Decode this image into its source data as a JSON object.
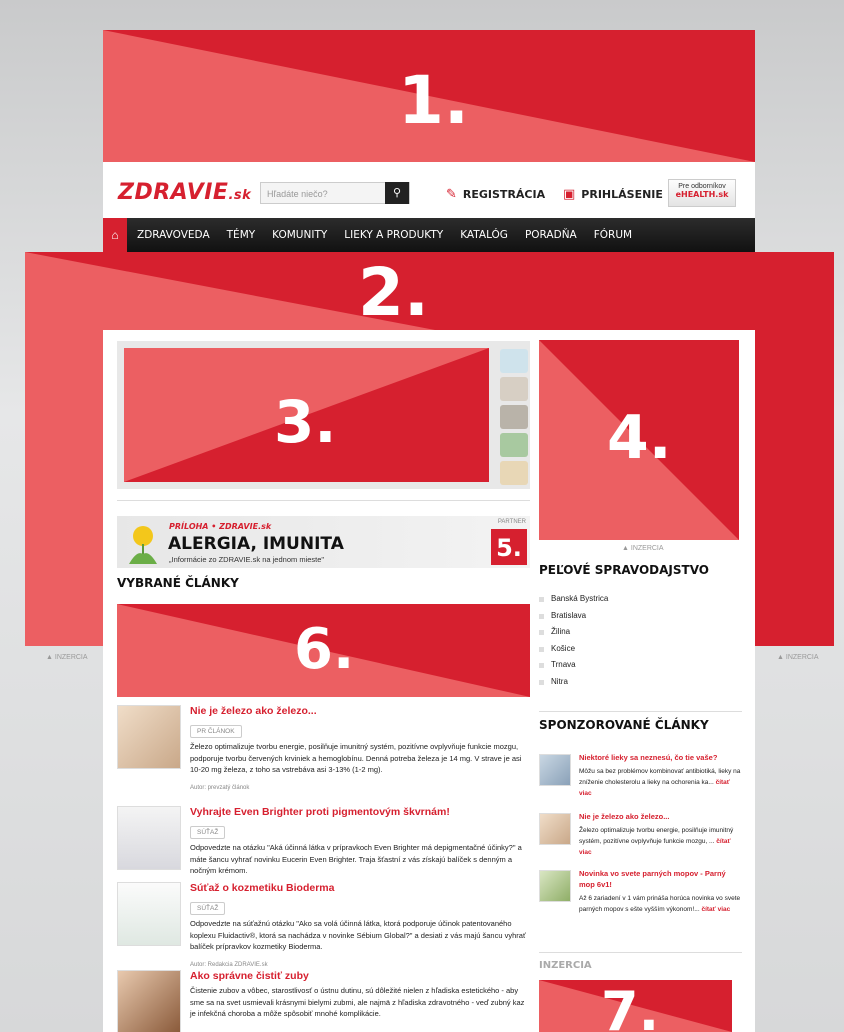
{
  "ads": {
    "ad1": "1.",
    "ad2": "2.",
    "ad3": "3.",
    "ad4": "4.",
    "ad5": "5.",
    "ad6": "6.",
    "ad7": "7.",
    "inzercia_small": "▲ INZERCIA",
    "inzercia_heading": "INZERCIA"
  },
  "header": {
    "logo": "ZDRAVIE",
    "logo_suffix": ".sk",
    "search_placeholder": "Hľadáte niečo?",
    "register": "REGISTRÁCIA",
    "login": "PRIHLÁSENIE",
    "ehealth_line1": "Pre odborníkov",
    "ehealth_line2": "eHEALTH.sk"
  },
  "nav": [
    "ZDRAVOVEDA",
    "TÉMY",
    "KOMUNITY",
    "LIEKY A PRODUKTY",
    "KATALÓG",
    "PORADŇA",
    "FÓRUM"
  ],
  "partner_banner": {
    "priloha": "PRÍLOHA • ZDRAVIE.sk",
    "title": "ALERGIA, IMUNITA",
    "subtitle": "„Informácie zo ZDRAVIE.sk na jednom mieste\"",
    "partner": "PARTNER"
  },
  "main": {
    "selected_title": "VYBRANÉ ČLÁNKY",
    "articles": [
      {
        "title": "Nie je železo ako železo...",
        "tag": "PR ČLÁNOK",
        "text": "Železo optimalizuje tvorbu energie, posilňuje imunitný systém, pozitívne ovplyvňuje funkcie mozgu, podporuje tvorbu červených krviniek a hemoglobínu. Denná potreba železa je 14 mg. V strave je asi 10-20 mg železa, z toho sa vstrebáva asi 3-13% (1-2 mg).",
        "autor": "Autor: prevzatý článok"
      },
      {
        "title": "Vyhrajte Even Brighter proti pigmentovým škvrnám!",
        "tag": "SÚŤAŽ",
        "text": "Odpovedzte na otázku \"Aká účinná látka v prípravkoch Even Brighter má depigmentačné účinky?\" a máte šancu vyhrať novinku Eucerin Even Brighter. Traja šťastní z vás získajú balíček s denným a nočným krémom.",
        "autor": ""
      },
      {
        "title": "Súťaž o kozmetiku Bioderma",
        "tag": "SÚŤAŽ",
        "text": "Odpovedzte na súťažnú otázku \"Ako sa volá účinná látka, ktorá podporuje účinok patentovaného koplexu Fluidactiv®, ktorá sa nachádza v novinke Sébium Global?\" a desiati z vás majú šancu vyhrať balíček prípravkov kozmetiky Bioderma.",
        "autor": "Autor: Redakcia ZDRAVIE.sk"
      },
      {
        "title": "Ako správne čistiť zuby",
        "tag": "",
        "text": "Čistenie zubov a vôbec, starostlivosť o ústnu dutinu, sú dôležité nielen z hľadiska estetického - aby sme sa na svet usmievali krásnymi bielymi zubmi, ale najmä z hľadiska zdravotného - veď zubný kaz je infekčná choroba a môže spôsobiť mnohé komplikácie.",
        "autor": ""
      }
    ]
  },
  "sidebar": {
    "pollen_title": "PEĽOVÉ SPRAVODAJSTVO",
    "cities": [
      "Banská Bystrica",
      "Bratislava",
      "Žilina",
      "Košice",
      "Trnava",
      "Nitra"
    ],
    "sponsored_title": "SPONZOROVANÉ ČLÁNKY",
    "sponsored": [
      {
        "title": "Niektoré lieky sa neznesú, čo tie vaše?",
        "text": "Môžu sa bez problémov kombinovať antibiotiká, lieky na zníženie cholesterolu a lieky na ochorenia ka...",
        "more": "čítať viac"
      },
      {
        "title": "Nie je železo ako železo...",
        "text": "Železo optimalizuje tvorbu energie, posilňuje imunitný systém, pozitívne ovplyvňuje funkcie mozgu, ...",
        "more": "čítať viac"
      },
      {
        "title": "Novinka vo svete parných mopov - Parný mop 6v1!",
        "text": "Až 6 zariadení v 1 vám prináša horúca novinka vo svete parných mopov s ešte vyšším výkonom!...",
        "more": "čítať viac"
      }
    ]
  },
  "colors": {
    "brand": "#d6202f",
    "brand_light": "#ec5f62",
    "nav_bg": "#1a1a1a"
  }
}
